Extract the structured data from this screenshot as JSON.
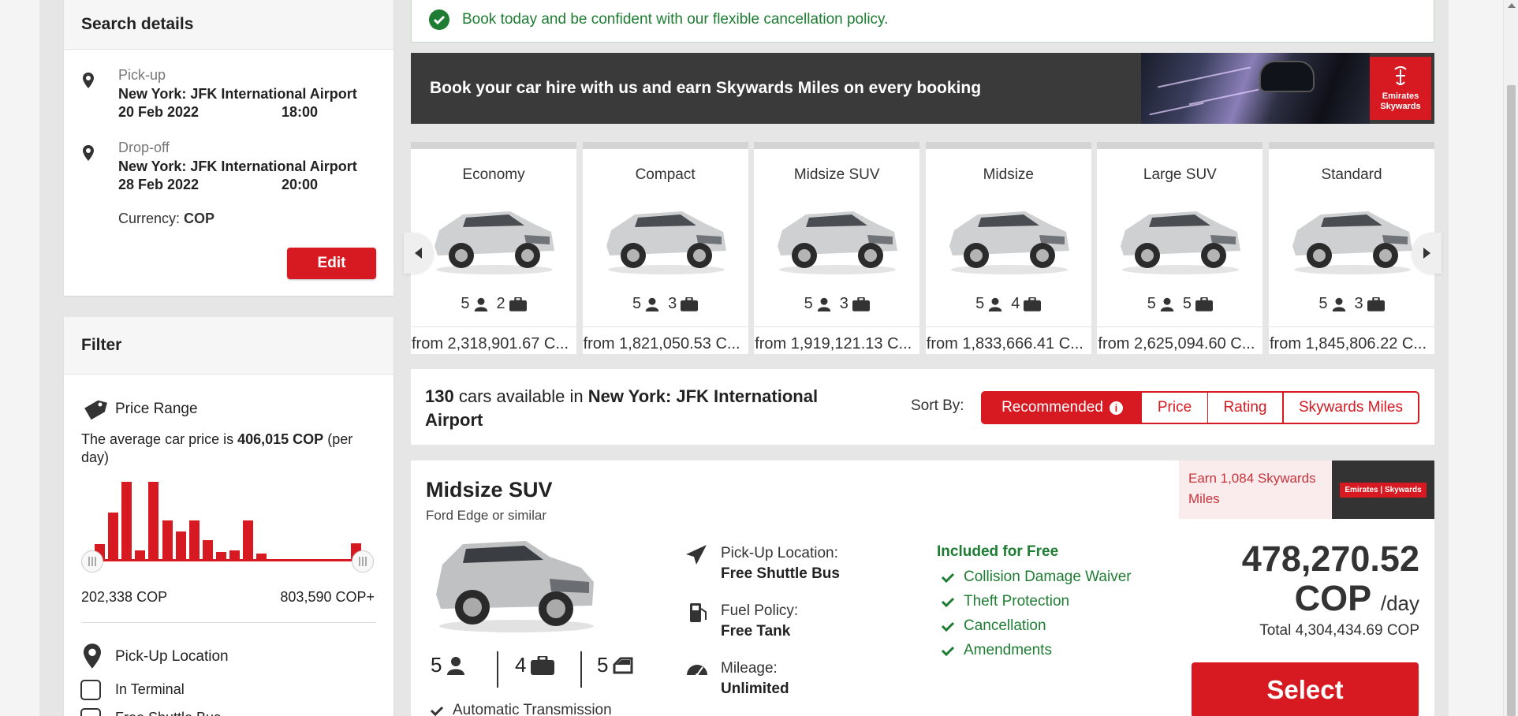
{
  "search_details": {
    "title": "Search details",
    "pickup_label": "Pick-up",
    "pickup_location": "New York: JFK International Airport",
    "pickup_date": "20 Feb 2022",
    "pickup_time": "18:00",
    "dropoff_label": "Drop-off",
    "dropoff_location": "New York: JFK International Airport",
    "dropoff_date": "28 Feb 2022",
    "dropoff_time": "20:00",
    "currency_label": "Currency:",
    "currency_value": "COP",
    "edit_label": "Edit"
  },
  "filter": {
    "title": "Filter",
    "price_range_title": "Price Range",
    "avg_prefix": "The average car price is",
    "avg_value": "406,015 COP",
    "avg_suffix": "(per day)",
    "min_label": "202,338 COP",
    "max_label": "803,590 COP+",
    "histogram": [
      0.17,
      0.48,
      0.78,
      0.11,
      0.78,
      0.4,
      0.29,
      0.4,
      0.21,
      0.09,
      0.11,
      0.4,
      0.08,
      0.0,
      0.0,
      0.0,
      0.0,
      0.0,
      0.0,
      0.18
    ],
    "pickup_location_title": "Pick-Up Location",
    "options": [
      "In Terminal",
      "Free Shuttle Bus"
    ]
  },
  "notice": {
    "text": "Book today and be confident with our flexible cancellation policy."
  },
  "promo": {
    "text": "Book your car hire with us and earn Skywards Miles on every booking",
    "logo_line1": "Emirates",
    "logo_line2": "Skywards"
  },
  "categories": [
    {
      "name": "Economy",
      "seats": "5",
      "bags": "2",
      "price": "from 2,318,901.67 C..."
    },
    {
      "name": "Compact",
      "seats": "5",
      "bags": "3",
      "price": "from 1,821,050.53 C..."
    },
    {
      "name": "Midsize SUV",
      "seats": "5",
      "bags": "3",
      "price": "from 1,919,121.13 C..."
    },
    {
      "name": "Midsize",
      "seats": "5",
      "bags": "4",
      "price": "from 1,833,666.41 C..."
    },
    {
      "name": "Large SUV",
      "seats": "5",
      "bags": "5",
      "price": "from 2,625,094.60 C..."
    },
    {
      "name": "Standard",
      "seats": "5",
      "bags": "3",
      "price": "from 1,845,806.22 C..."
    }
  ],
  "availability": {
    "count": "130",
    "middle": "cars available in",
    "location": "New York: JFK International Airport",
    "sort_label": "Sort By:",
    "sort_options": [
      "Recommended",
      "Price",
      "Rating",
      "Skywards Miles"
    ]
  },
  "result": {
    "title": "Midsize SUV",
    "subtitle": "Ford Edge or similar",
    "seats": "5",
    "bags": "4",
    "doors": "5",
    "pickup_label": "Pick-Up Location:",
    "pickup_value": "Free Shuttle Bus",
    "fuel_label": "Fuel Policy:",
    "fuel_value": "Free Tank",
    "mileage_label": "Mileage:",
    "mileage_value": "Unlimited",
    "included_title": "Included for Free",
    "included": [
      "Collision Damage Waiver",
      "Theft Protection",
      "Cancellation",
      "Amendments"
    ],
    "earn_text": "Earn 1,084 Skywards Miles",
    "logo_text": "Emirates | Skywards",
    "price": "478,270.52",
    "currency": "COP",
    "per_day": "/day",
    "total": "Total 4,304,434.69 COP",
    "select_label": "Select",
    "transmission": "Automatic Transmission"
  },
  "colors": {
    "brand_red": "#d71a21",
    "green": "#1e7d32"
  }
}
